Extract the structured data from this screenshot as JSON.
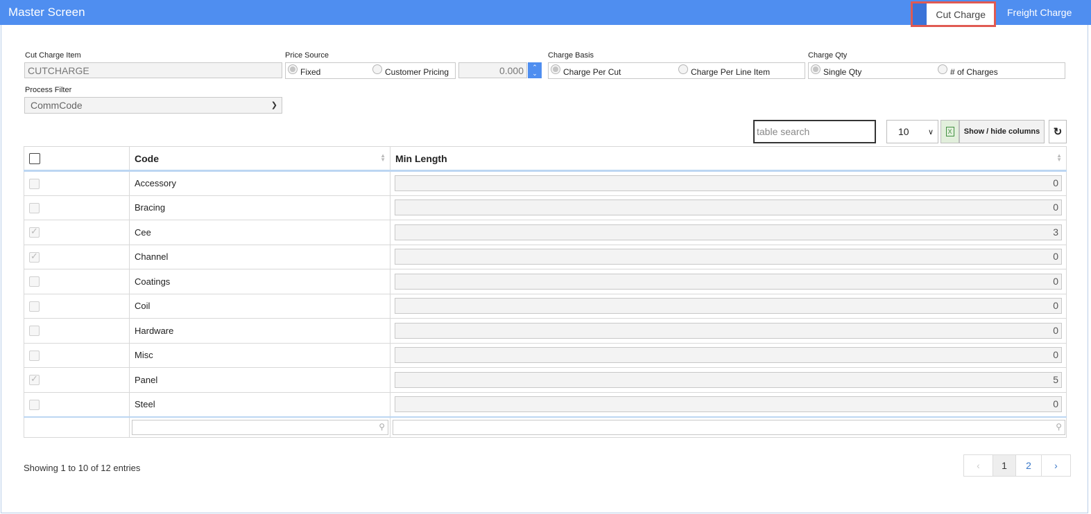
{
  "header": {
    "title": "Master Screen",
    "tabs": [
      {
        "label": "Cut Charge",
        "active": true
      },
      {
        "label": "Freight Charge",
        "active": false
      }
    ]
  },
  "form": {
    "cut_charge_item": {
      "label": "Cut Charge Item",
      "value": "CUTCHARGE"
    },
    "price_source": {
      "label": "Price Source",
      "options": [
        {
          "label": "Fixed",
          "selected": true
        },
        {
          "label": "Customer Pricing",
          "selected": false
        }
      ],
      "amount": "0.000"
    },
    "charge_basis": {
      "label": "Charge Basis",
      "options": [
        {
          "label": "Charge Per Cut",
          "selected": true
        },
        {
          "label": "Charge Per Line Item",
          "selected": false
        }
      ]
    },
    "charge_qty": {
      "label": "Charge Qty",
      "options": [
        {
          "label": "Single Qty",
          "selected": true
        },
        {
          "label": "# of Charges",
          "selected": false
        }
      ]
    },
    "process_filter": {
      "label": "Process Filter",
      "value": "CommCode"
    }
  },
  "toolbar": {
    "search_placeholder": "table search",
    "page_length": "10",
    "excel_icon": "excel-icon",
    "colvis_label": "Show / hide columns",
    "reset_icon": "refresh-icon"
  },
  "table": {
    "columns": [
      "Code",
      "Min Length"
    ],
    "rows": [
      {
        "checked": false,
        "code": "Accessory",
        "min_length": "0"
      },
      {
        "checked": false,
        "code": "Bracing",
        "min_length": "0"
      },
      {
        "checked": true,
        "code": "Cee",
        "min_length": "3"
      },
      {
        "checked": true,
        "code": "Channel",
        "min_length": "0"
      },
      {
        "checked": false,
        "code": "Coatings",
        "min_length": "0"
      },
      {
        "checked": false,
        "code": "Coil",
        "min_length": "0"
      },
      {
        "checked": false,
        "code": "Hardware",
        "min_length": "0"
      },
      {
        "checked": false,
        "code": "Misc",
        "min_length": "0"
      },
      {
        "checked": true,
        "code": "Panel",
        "min_length": "5"
      },
      {
        "checked": false,
        "code": "Steel",
        "min_length": "0"
      }
    ]
  },
  "footer": {
    "info": "Showing 1 to 10 of 12 entries",
    "pagination": {
      "prev": "‹",
      "pages": [
        "1",
        "2"
      ],
      "current": "1",
      "next": "›"
    }
  },
  "colors": {
    "header_bg": "#4f8ef0",
    "highlight": "#e05a52",
    "accent": "#3b73d8"
  }
}
